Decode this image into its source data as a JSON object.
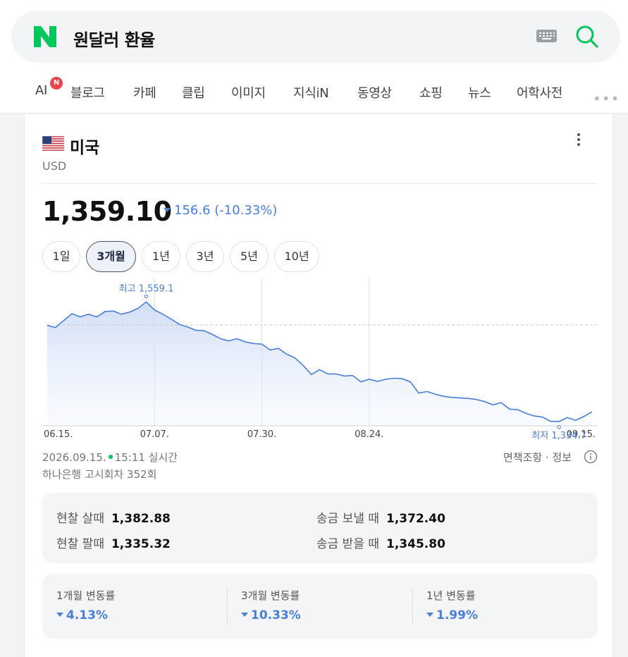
{
  "search": {
    "logo_letter": "N",
    "query": "원달러 환율"
  },
  "tabs": [
    {
      "label": "AI",
      "badge": "N"
    },
    {
      "label": "블로그"
    },
    {
      "label": "카페"
    },
    {
      "label": "클립"
    },
    {
      "label": "이미지"
    },
    {
      "label": "지식iN"
    },
    {
      "label": "동영상"
    },
    {
      "label": "쇼핑"
    },
    {
      "label": "뉴스"
    },
    {
      "label": "어학사전"
    }
  ],
  "more_label": "•••",
  "card": {
    "country": "미국",
    "currency_code": "USD",
    "rate": "1,359.10",
    "change": "156.6 (-10.33%)",
    "periods": [
      "1일",
      "3개월",
      "1년",
      "3년",
      "5년",
      "10년"
    ],
    "active_period": "3개월",
    "timestamp_date": "2026.09.15.",
    "timestamp_time": "15:11 실시간",
    "notice": "하나은행 고시회차 352회",
    "disclaimer": "면책조항 · 정보",
    "cash": {
      "buy_cash_label": "현찰 살때",
      "buy_cash_value": "1,382.88",
      "sell_cash_label": "현찰 팔때",
      "sell_cash_value": "1,335.32",
      "send_label": "송금 보낼 때",
      "send_value": "1,372.40",
      "receive_label": "송금 받을 때",
      "receive_value": "1,345.80"
    },
    "changes": [
      {
        "label": "1개월 변동률",
        "value": "4.13%"
      },
      {
        "label": "3개월 변동률",
        "value": "10.33%"
      },
      {
        "label": "1년 변동률",
        "value": "1.99%"
      }
    ]
  },
  "colors": {
    "brand_green": "#03c75a",
    "line_blue": "#4a7ed8",
    "down_blue": "#4a7ed8",
    "badge_red": "#f0424b"
  },
  "chart_data": {
    "type": "area",
    "x_tick_labels": [
      "06.15.",
      "07.07.",
      "07.30.",
      "08.24.",
      "09.15."
    ],
    "high_label": "최고 1,559.1",
    "low_label": "최저 1,334.7",
    "high": 1559.1,
    "low": 1334.7,
    "reference": 1515.7,
    "values": [
      1515,
      1511,
      1524,
      1537,
      1531,
      1536,
      1531,
      1541,
      1542,
      1536,
      1540,
      1547,
      1559,
      1544,
      1536,
      1527,
      1517,
      1512,
      1506,
      1505,
      1498,
      1490,
      1486,
      1490,
      1484,
      1481,
      1480,
      1469,
      1472,
      1461,
      1454,
      1440,
      1423,
      1432,
      1424,
      1424,
      1420,
      1421,
      1409,
      1414,
      1410,
      1414,
      1416,
      1415,
      1409,
      1388,
      1391,
      1386,
      1382,
      1380,
      1379,
      1378,
      1376,
      1372,
      1366,
      1370,
      1358,
      1357,
      1350,
      1345,
      1343,
      1335,
      1334.7,
      1342,
      1337,
      1344,
      1353
    ],
    "grid": true
  }
}
